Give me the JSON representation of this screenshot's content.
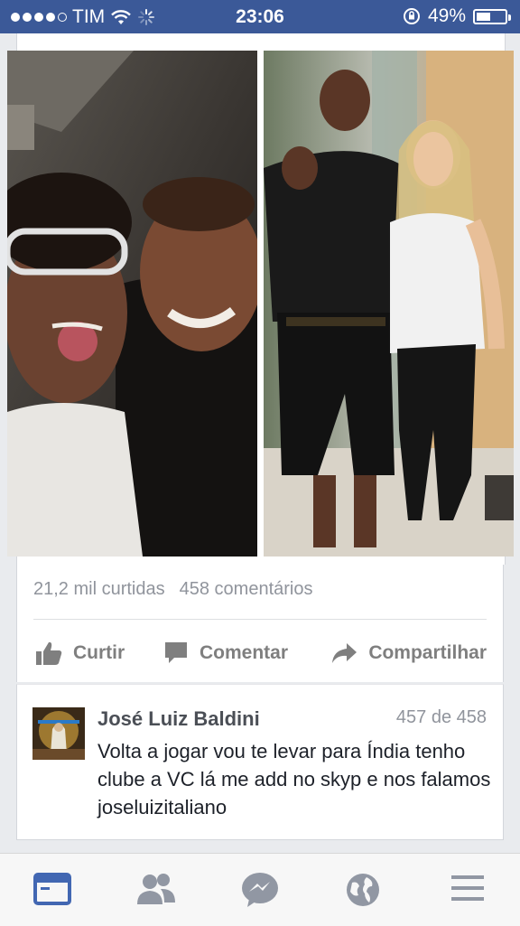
{
  "status_bar": {
    "carrier": "TIM",
    "time": "23:06",
    "battery": "49%",
    "battery_level": 0.49
  },
  "post": {
    "stats": {
      "likes": "21,2 mil curtidas",
      "comments": "458 comentários"
    },
    "actions": {
      "like": "Curtir",
      "comment": "Comentar",
      "share": "Compartilhar"
    }
  },
  "comment": {
    "author": "José Luiz Baldini",
    "position": "457 de 458",
    "text": "Volta a jogar vou te levar para Índia tenho clube a VC lá me add no skyp e nos falamos joseluizitaliano"
  },
  "tab_bar": {
    "tabs": [
      "news-feed-icon",
      "friends-icon",
      "messenger-icon",
      "globe-icon",
      "menu-icon"
    ],
    "active_color": "#4267b2",
    "inactive_color": "#9197a3"
  },
  "colors": {
    "brand": "#3b5998",
    "background": "#e9ebee"
  }
}
